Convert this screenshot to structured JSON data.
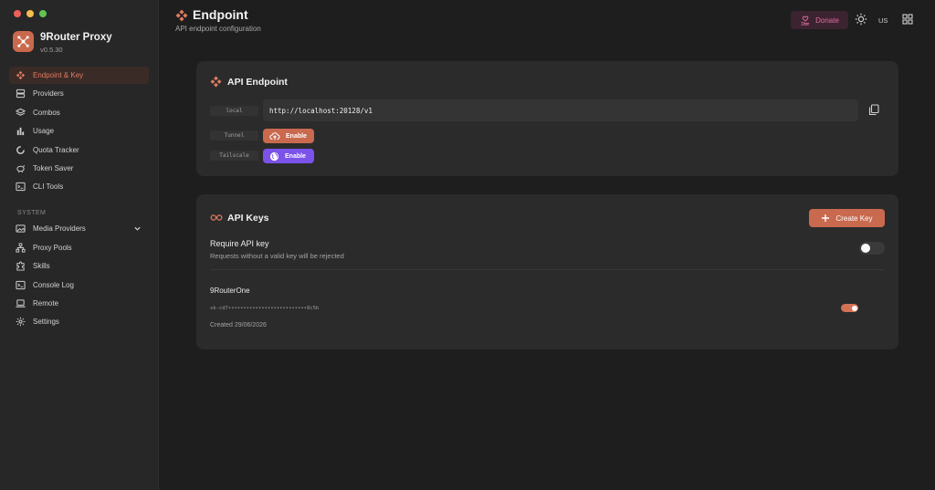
{
  "app": {
    "name": "9Router Proxy",
    "version": "v0.5.30"
  },
  "sidebar": {
    "items": [
      {
        "label": "Endpoint & Key",
        "icon": "endpoint-icon",
        "active": true
      },
      {
        "label": "Providers",
        "icon": "providers-icon"
      },
      {
        "label": "Combos",
        "icon": "layers-icon"
      },
      {
        "label": "Usage",
        "icon": "bar-chart-icon"
      },
      {
        "label": "Quota Tracker",
        "icon": "donut-icon"
      },
      {
        "label": "Token Saver",
        "icon": "piggy-bank-icon"
      },
      {
        "label": "CLI Tools",
        "icon": "terminal-icon"
      }
    ],
    "system_label": "SYSTEM",
    "system_items": [
      {
        "label": "Media Providers",
        "icon": "media-icon",
        "expandable": true
      },
      {
        "label": "Proxy Pools",
        "icon": "network-icon"
      },
      {
        "label": "Skills",
        "icon": "puzzle-icon"
      },
      {
        "label": "Console Log",
        "icon": "console-icon"
      },
      {
        "label": "Remote",
        "icon": "laptop-icon"
      },
      {
        "label": "Settings",
        "icon": "gear-icon"
      }
    ]
  },
  "header": {
    "title": "Endpoint",
    "subtitle": "API endpoint configuration",
    "donate_label": "Donate",
    "lang": "US"
  },
  "endpoint_card": {
    "title": "API Endpoint",
    "local_label": "local",
    "local_url": "http://localhost:20128/v1",
    "tunnel_label": "Tunnel",
    "tunnel_button": "Enable",
    "tailscale_label": "Tailscale",
    "tailscale_button": "Enable"
  },
  "keys_card": {
    "title": "API Keys",
    "create_button": "Create Key",
    "require_title": "Require API key",
    "require_subtitle": "Requests without a valid key will be rejected",
    "require_enabled": false,
    "keys": [
      {
        "name": "9RouterOne",
        "masked": "sk-cd7••••••••••••••••••••••••••8c5b",
        "created": "Created 29/06/2026",
        "enabled": true
      }
    ]
  },
  "colors": {
    "accent": "#c9694e",
    "tailscale": "#7b52ea",
    "donate": "#e66aa2",
    "background": "#1e1e1e",
    "sidebar": "#272727",
    "card": "#2b2b2b"
  }
}
